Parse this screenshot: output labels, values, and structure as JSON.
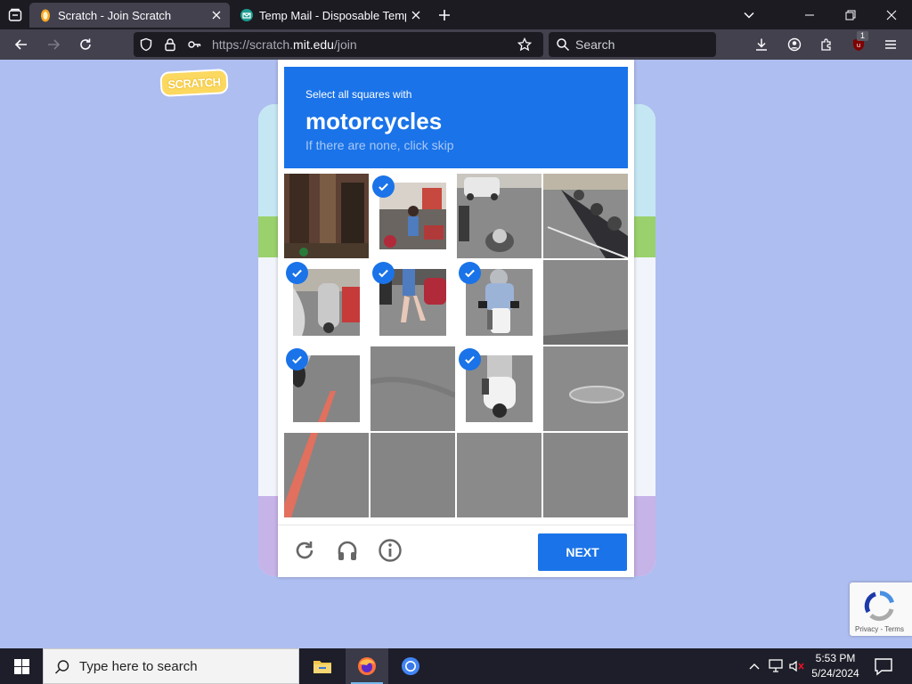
{
  "browser": {
    "tabs": [
      {
        "title": "Scratch - Join Scratch",
        "active": true
      },
      {
        "title": "Temp Mail - Disposable Tempor",
        "active": false
      }
    ],
    "url": {
      "prefix": "https://scratch.",
      "domain": "mit.edu",
      "path": "/join"
    },
    "search_placeholder": "Search",
    "extension_badge": "1"
  },
  "page": {
    "logo_text": "SCRATCH"
  },
  "captcha": {
    "instruction_line": "Select all squares with",
    "target": "motorcycles",
    "hint": "If there are none, click skip",
    "next_label": "NEXT",
    "tiles_selected": [
      [
        false,
        true,
        false,
        false
      ],
      [
        true,
        true,
        true,
        false
      ],
      [
        true,
        false,
        true,
        false
      ],
      [
        false,
        false,
        false,
        false
      ]
    ]
  },
  "recaptcha": {
    "links": "Privacy - Terms"
  },
  "taskbar": {
    "search_placeholder": "Type here to search",
    "time": "5:53 PM",
    "date": "5/24/2024"
  },
  "colors": {
    "accent": "#1a73e8",
    "page_bg": "#aebef0"
  }
}
